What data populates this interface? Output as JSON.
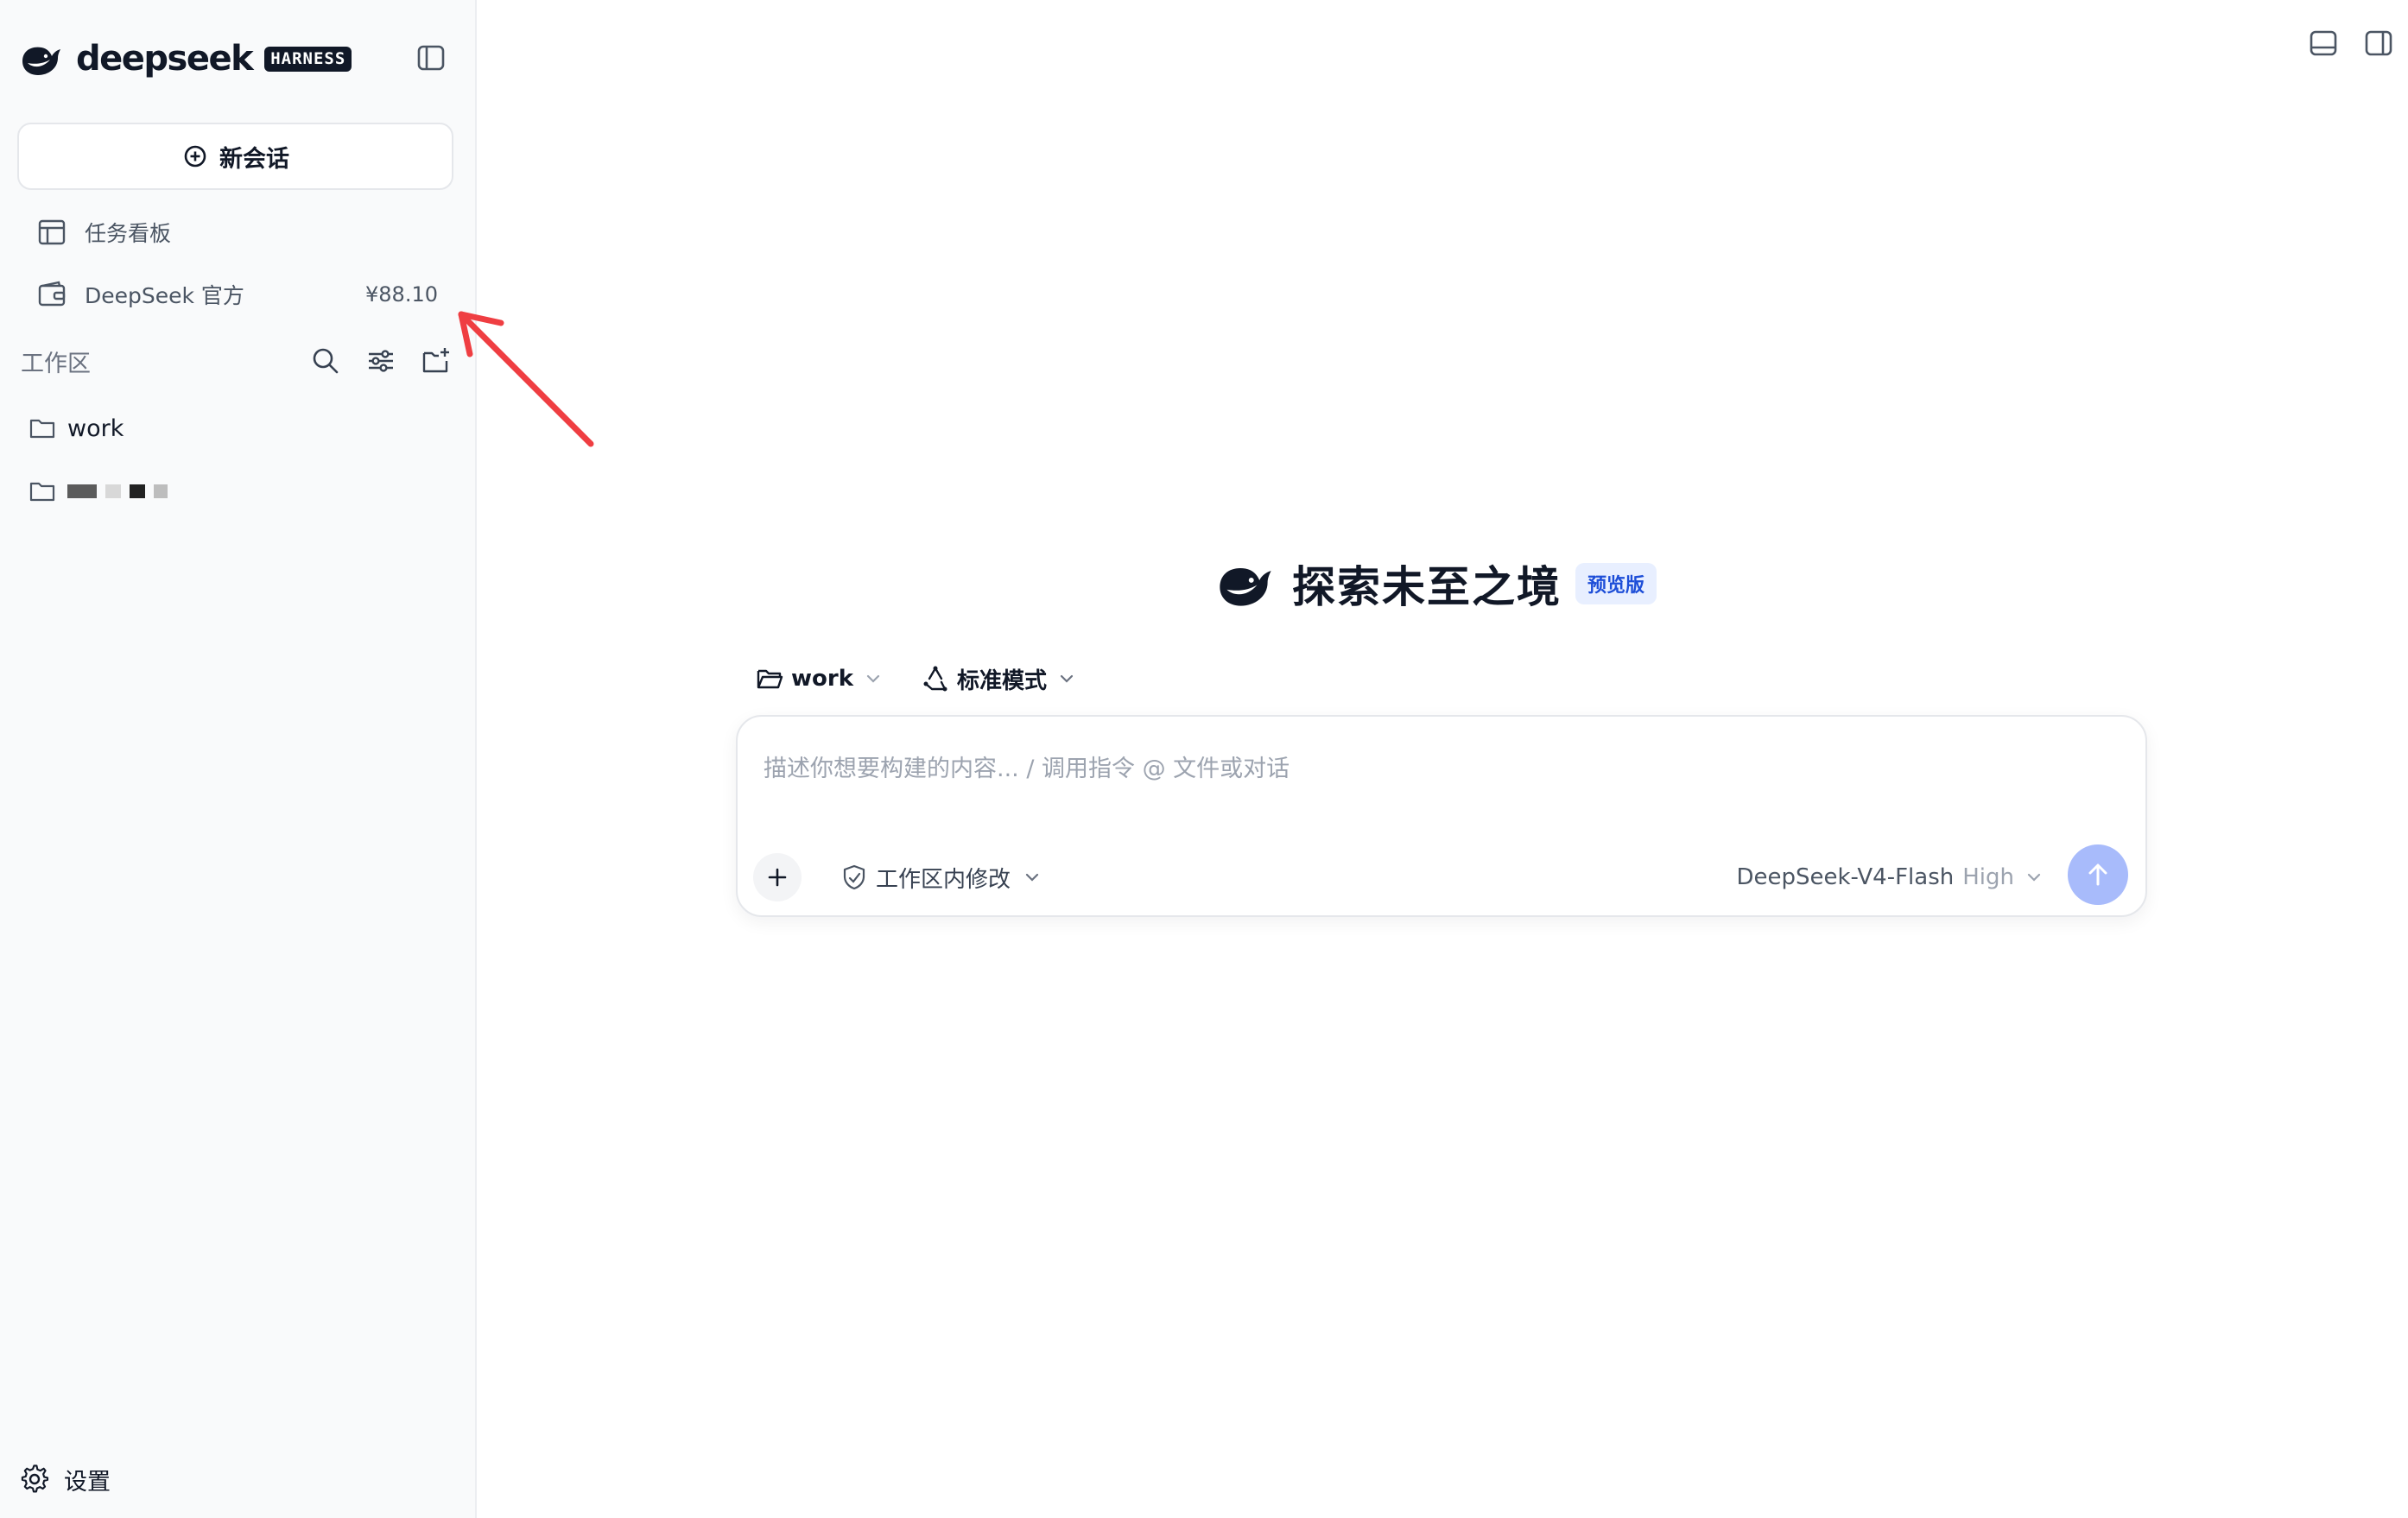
{
  "brand": {
    "name": "deepseek",
    "tag": "HARNESS"
  },
  "sidebar": {
    "new_chat_label": "新会话",
    "nav": [
      {
        "label": "任务看板",
        "icon": "board-icon"
      },
      {
        "label": "DeepSeek 官方",
        "amount": "¥88.10",
        "icon": "wallet-icon"
      }
    ],
    "workspace_label": "工作区",
    "folders": [
      {
        "label": "work",
        "icon": "folder-icon"
      },
      {
        "label": "",
        "redacted": true,
        "icon": "folder-icon"
      }
    ],
    "settings_label": "设置"
  },
  "welcome": {
    "title": "探索未至之境",
    "badge": "预览版"
  },
  "selectors": {
    "folder": "work",
    "mode": "标准模式"
  },
  "composer": {
    "placeholder": "描述你想要构建的内容... / 调用指令 @ 文件或对话",
    "permission": "工作区内修改",
    "model": "DeepSeek-V4-Flash",
    "effort": "High"
  },
  "colors": {
    "accent": "#a8bbfb",
    "badge_bg": "#e8efff",
    "badge_text": "#1d4ed8",
    "annotation_arrow": "#ef3e42",
    "sidebar_bg": "#f9fafb"
  }
}
